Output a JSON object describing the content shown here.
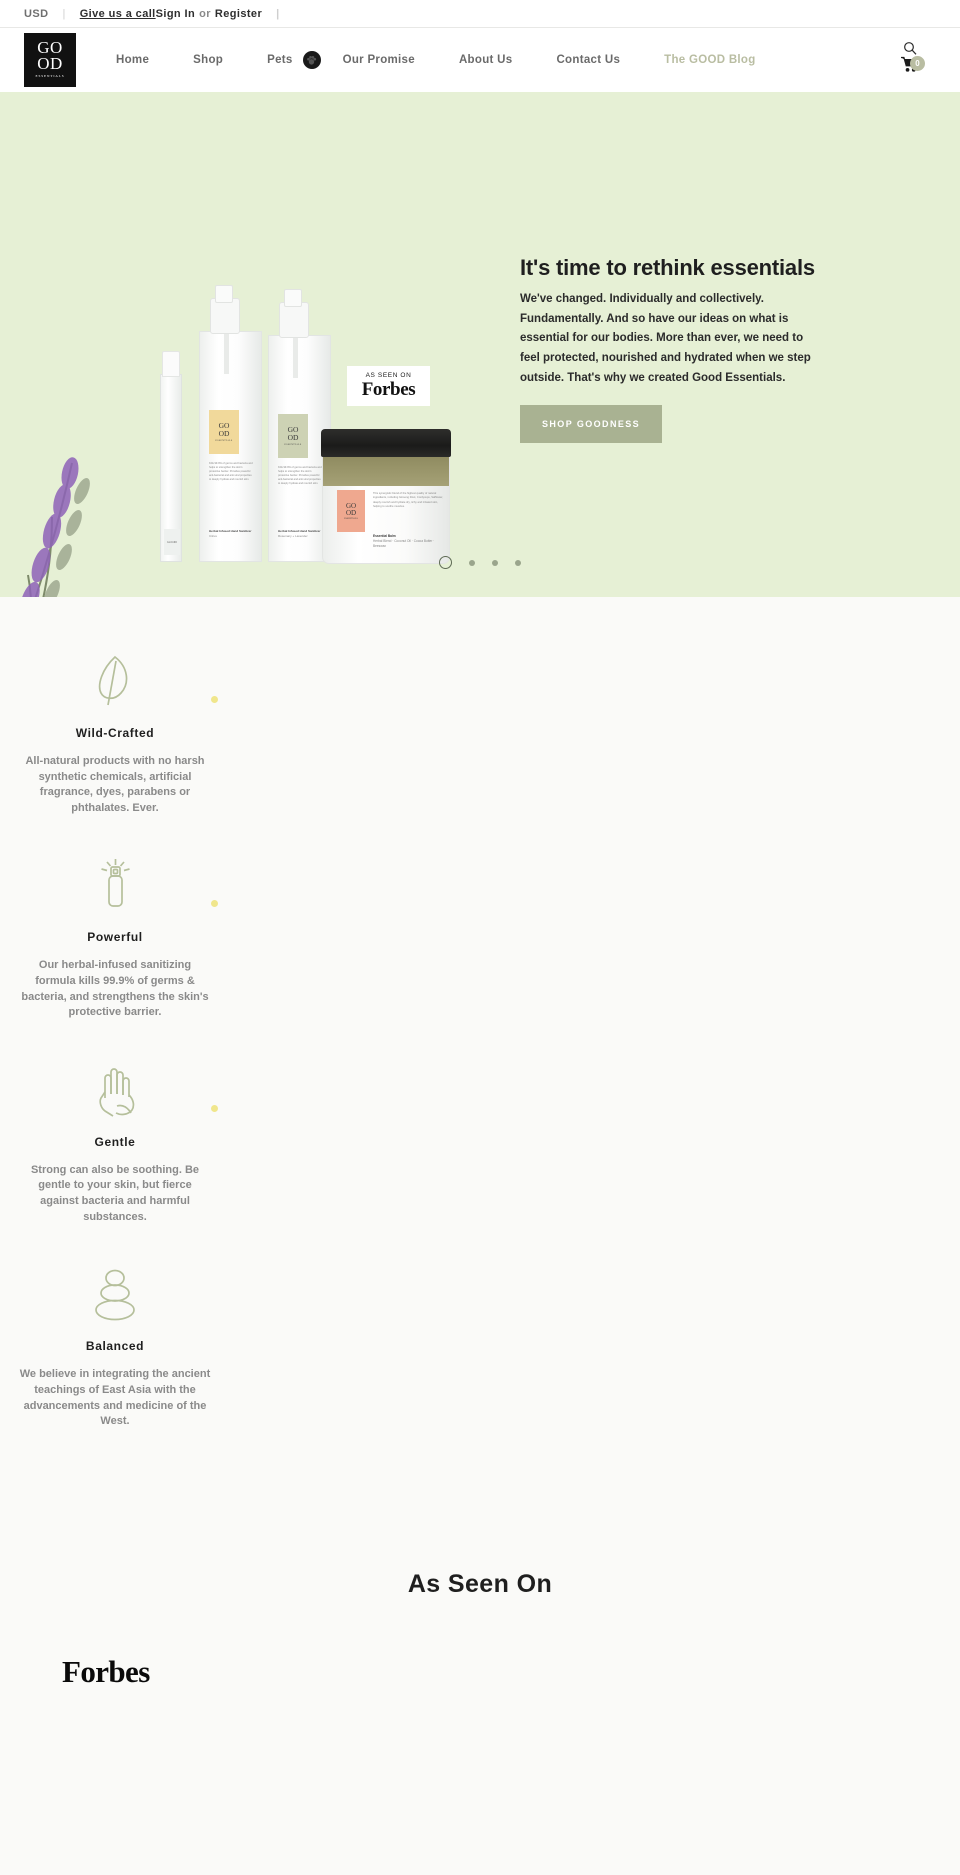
{
  "utility": {
    "currency": "USD",
    "call_link": "Give us a call",
    "sign_in": "Sign In",
    "or": "or",
    "register": "Register"
  },
  "header": {
    "logo": {
      "line1": "GO",
      "line2": "OD",
      "line3": "ESSENTIALS"
    },
    "nav": [
      {
        "label": "Home",
        "active": false
      },
      {
        "label": "Shop",
        "active": false
      },
      {
        "label": "Pets",
        "active": false
      },
      {
        "label": "Our Promise",
        "active": false
      },
      {
        "label": "About Us",
        "active": false
      },
      {
        "label": "Contact Us",
        "active": false
      },
      {
        "label": "The GOOD Blog",
        "active": true
      }
    ],
    "paw_icon": "paw-icon",
    "search_icon": "search-icon",
    "cart_icon": "cart-icon",
    "cart_count": "0",
    "blog_color": "#b9bda2"
  },
  "hero": {
    "background_color": "#e6f0d5",
    "title": "It's time to rethink essentials",
    "body": "We've changed. Individually and collectively. Fundamentally. And so have our ideas on what is essential for our bodies. More than ever, we need to feel protected, nourished and hydrated when we step outside. That's why we created Good Essentials.",
    "cta_label": "SHOP GOODNESS",
    "cta_color": "#a9b292",
    "forbes_tag": {
      "eyebrow": "AS SEEN ON",
      "brand": "Forbes"
    },
    "products": {
      "pen": {
        "brand": "GO OD"
      },
      "spray_citrus": {
        "brand_top": "GO",
        "brand_bottom": "OD",
        "brand_sub": "ESSENTIALS",
        "body": "Kills 99.9% of germs and bacteria and helps to strengthen the skin's protective barrier. Provides powerful anti-bacterial and anti-viral properties to deeply hydrate and nourish skin.",
        "name": "Herbal Infused Hand Sanitizer",
        "variant": "Citrus",
        "swatch_color": "#f1d99b"
      },
      "spray_rosemary": {
        "brand_top": "GO",
        "brand_bottom": "OD",
        "brand_sub": "ESSENTIALS",
        "body": "Kills 99.9% of germs and bacteria and helps to strengthen the skin's protective barrier. Provides powerful anti-bacterial and anti-viral properties to deeply hydrate and nourish skin.",
        "name": "Herbal Infused Hand Sanitizer",
        "variant": "Rosemary + Lavender",
        "swatch_color": "#cdd2b4"
      },
      "balm": {
        "brand_top": "GO",
        "brand_bottom": "OD",
        "brand_sub": "ESSENTIALS",
        "body": "This synergistic blend of the highest quality of natural ingredients, including Ginseng Root, Cordyceps, Safflower, deeply nourish and hydrate dry, itchy and irritated skin, helping to soothe muscles.",
        "name": "Essential Balm",
        "variant": "Herbal Blend  ·  Coconut Oil  ·  Cocoa Butter  ·  Beeswax",
        "swatch_color": "#efa88f"
      }
    },
    "carousel": {
      "slides": 4,
      "active_index": 0
    }
  },
  "features": [
    {
      "icon": "leaf-icon",
      "title": "Wild-Crafted",
      "text": "All-natural products with no harsh synthetic chemicals, artificial fragrance, dyes, parabens or phthalates. Ever."
    },
    {
      "icon": "spray-bottle-icon",
      "title": "Powerful",
      "text": "Our herbal-infused sanitizing formula kills 99.9% of germs & bacteria, and strengthens the skin's protective barrier."
    },
    {
      "icon": "hand-leaf-icon",
      "title": "Gentle",
      "text": "Strong can also be soothing. Be gentle to your skin, but fierce against bacteria and harmful substances."
    },
    {
      "icon": "stacked-stones-icon",
      "title": "Balanced",
      "text": "We believe in integrating the ancient teachings of East Asia with the advancements and medicine of the West."
    }
  ],
  "as_seen_on": {
    "title": "As Seen On",
    "logos": [
      {
        "name": "Forbes"
      }
    ]
  }
}
